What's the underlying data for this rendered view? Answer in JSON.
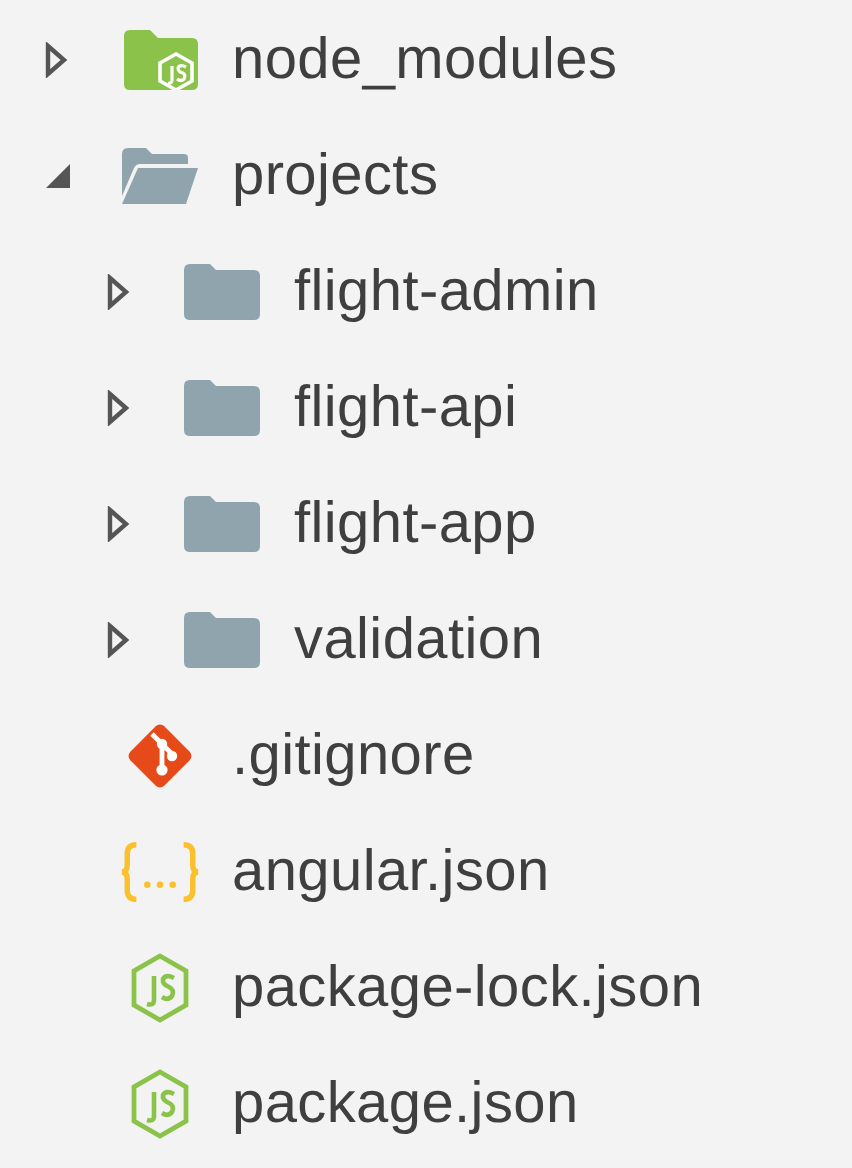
{
  "tree": [
    {
      "label": "node_modules",
      "kind": "node-folder",
      "expanded": false
    },
    {
      "label": "projects",
      "kind": "folder",
      "expanded": true,
      "children": [
        {
          "label": "flight-admin",
          "kind": "folder",
          "expanded": false
        },
        {
          "label": "flight-api",
          "kind": "folder",
          "expanded": false
        },
        {
          "label": "flight-app",
          "kind": "folder",
          "expanded": false
        },
        {
          "label": "validation",
          "kind": "folder",
          "expanded": false
        }
      ]
    },
    {
      "label": ".gitignore",
      "kind": "git"
    },
    {
      "label": "angular.json",
      "kind": "json"
    },
    {
      "label": "package-lock.json",
      "kind": "node"
    },
    {
      "label": "package.json",
      "kind": "node"
    }
  ]
}
